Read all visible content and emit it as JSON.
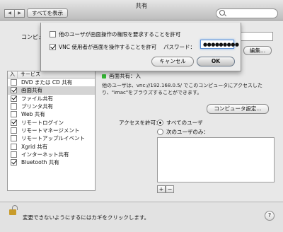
{
  "window": {
    "title": "共有",
    "back_glyph": "◀",
    "forward_glyph": "▶",
    "show_all": "すべてを表示"
  },
  "computer": {
    "label": "コンピュ",
    "edit_button": "編集..."
  },
  "services": {
    "header_on": "入",
    "header_service": "サービス",
    "items": [
      {
        "label": "DVD または CD 共有",
        "checked": false,
        "selected": false
      },
      {
        "label": "画面共有",
        "checked": true,
        "selected": true
      },
      {
        "label": "ファイル共有",
        "checked": true,
        "selected": false
      },
      {
        "label": "プリンタ共有",
        "checked": false,
        "selected": false
      },
      {
        "label": "Web 共有",
        "checked": false,
        "selected": false
      },
      {
        "label": "リモートログイン",
        "checked": true,
        "selected": false
      },
      {
        "label": "リモートマネージメント",
        "checked": false,
        "selected": false
      },
      {
        "label": "リモートアップルイベント",
        "checked": false,
        "selected": false
      },
      {
        "label": "Xgrid 共有",
        "checked": false,
        "selected": false
      },
      {
        "label": "インターネット共有",
        "checked": false,
        "selected": false
      },
      {
        "label": "Bluetooth 共有",
        "checked": true,
        "selected": false
      }
    ]
  },
  "detail": {
    "status": "画面共有：入",
    "description_line1": "他のユーザは、vnc://192.168.0.5/ でこのコンピュータにアクセスした",
    "description_line2": "り、\"imac\"をブラウズすることができます。",
    "computer_settings_button": "コンピュータ設定...",
    "access_label": "アクセスを許可：",
    "radio_all": "すべてのユーザ",
    "radio_only": "次のユーザのみ：",
    "add_glyph": "+",
    "remove_glyph": "−"
  },
  "sheet": {
    "option1": "他のユーザが画面操作の権限を要求することを許可",
    "option1_checked": false,
    "option2": "VNC 使用者が画面を操作することを許可",
    "option2_checked": true,
    "password_label": "パスワード：",
    "password_value": "●●●●●●●●●",
    "cancel": "キャンセル",
    "ok": "OK"
  },
  "footer": {
    "lock_text": "変更できないようにするにはカギをクリックします。",
    "help": "?"
  }
}
